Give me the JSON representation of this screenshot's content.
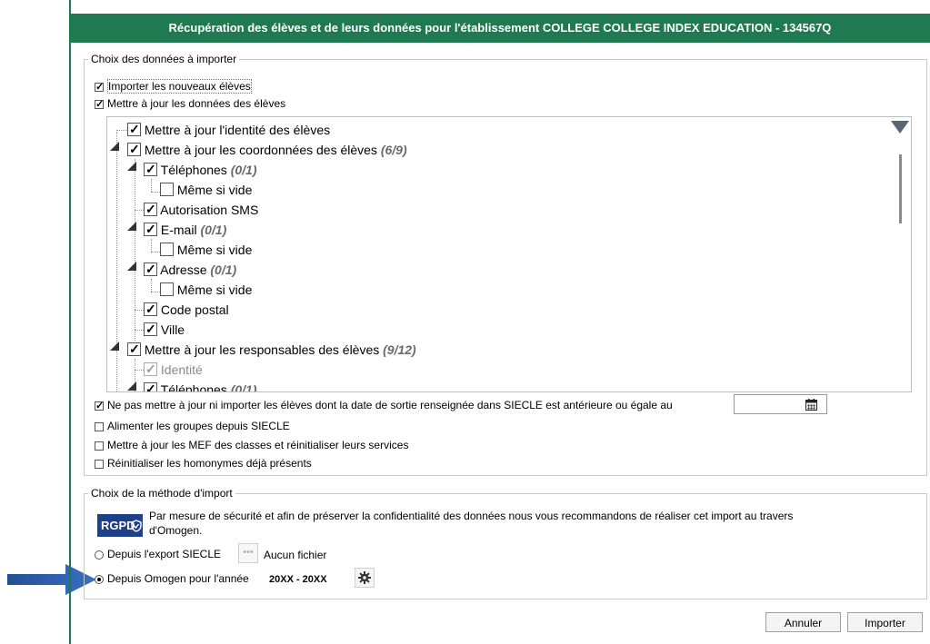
{
  "dialog": {
    "title": "Récupération des élèves et de leurs données pour l'établissement COLLEGE COLLEGE INDEX EDUCATION - 134567Q"
  },
  "data_group": {
    "legend": "Choix des données à importer",
    "import_new": {
      "label": "Importer les nouveaux élèves",
      "checked": true
    },
    "update_data": {
      "label": "Mettre à jour les données des élèves",
      "checked": true
    },
    "tree": [
      {
        "label": "Mettre à jour l'identité des élèves",
        "count": "",
        "checked": true
      },
      {
        "label": "Mettre à jour les coordonnées des élèves",
        "count": "(6/9)",
        "checked": true
      },
      {
        "label": "Téléphones",
        "count": "(0/1)",
        "checked": true
      },
      {
        "label": "Même si vide",
        "count": "",
        "checked": false
      },
      {
        "label": "Autorisation SMS",
        "count": "",
        "checked": true
      },
      {
        "label": "E-mail",
        "count": "(0/1)",
        "checked": true
      },
      {
        "label": "Même si vide",
        "count": "",
        "checked": false
      },
      {
        "label": "Adresse",
        "count": "(0/1)",
        "checked": true
      },
      {
        "label": "Même si vide",
        "count": "",
        "checked": false
      },
      {
        "label": "Code postal",
        "count": "",
        "checked": true
      },
      {
        "label": "Ville",
        "count": "",
        "checked": true
      },
      {
        "label": "Mettre à jour les responsables des élèves",
        "count": "(9/12)",
        "checked": true
      },
      {
        "label": "Identité",
        "count": "",
        "checked": true
      },
      {
        "label": "Téléphones",
        "count": "(0/1)",
        "checked": true
      }
    ],
    "exit_date": {
      "label": "Ne pas mettre à jour ni importer les élèves dont la date de sortie renseignée dans SIECLE est antérieure ou égale au",
      "checked": true,
      "value": ""
    },
    "groups": {
      "label": "Alimenter les groupes depuis SIECLE",
      "checked": false
    },
    "mef": {
      "label": "Mettre à jour les MEF des classes et réinitialiser leurs services",
      "checked": false
    },
    "homonyms": {
      "label": "Réinitialiser les homonymes déjà présents",
      "checked": false
    }
  },
  "method_group": {
    "legend": "Choix de la méthode d'import",
    "rgpd_badge": "RGPD",
    "rgpd_notice_line1": "Par mesure de sécurité et afin de préserver la confidentialité des données nous vous recommandons de réaliser cet import au travers",
    "rgpd_notice_line2": "d'Omogen.",
    "siecle": {
      "label": "Depuis l'export SIECLE",
      "file_text": "Aucun fichier",
      "selected": false
    },
    "omogen": {
      "label": "Depuis Omogen pour l'année",
      "year": "20XX - 20XX",
      "selected": true
    }
  },
  "buttons": {
    "cancel": "Annuler",
    "import": "Importer"
  },
  "colors": {
    "titlebar": "#1f7a52",
    "arrow": "#2f62ad",
    "rgpd_badge": "#1e3f8a"
  }
}
